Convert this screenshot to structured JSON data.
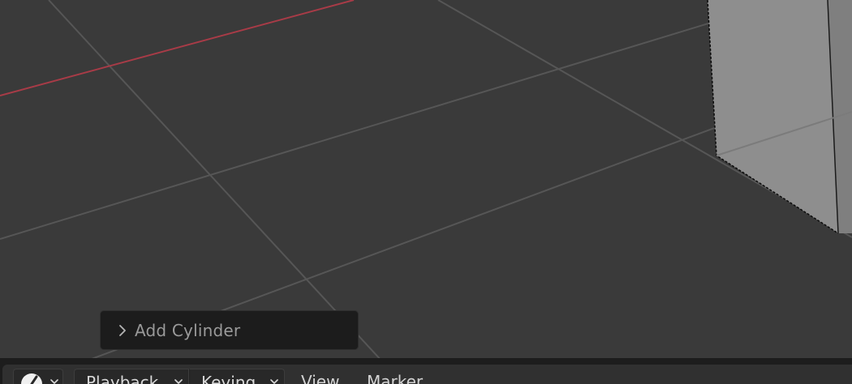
{
  "viewport": {
    "operator_panel": {
      "label": "Add Cylinder",
      "expand_icon": "chevron-right-icon"
    },
    "colors": {
      "background": "#3a3a3a",
      "grid": "#555555",
      "x_axis": "#a83b47",
      "object_face": "#8e8e8e",
      "object_outline": "#0b0b0b"
    }
  },
  "timeline": {
    "editor_type_icon": "clock-icon",
    "playback_label": "Playback",
    "keying_label": "Keying",
    "menu_view": "View",
    "menu_marker": "Marker"
  }
}
